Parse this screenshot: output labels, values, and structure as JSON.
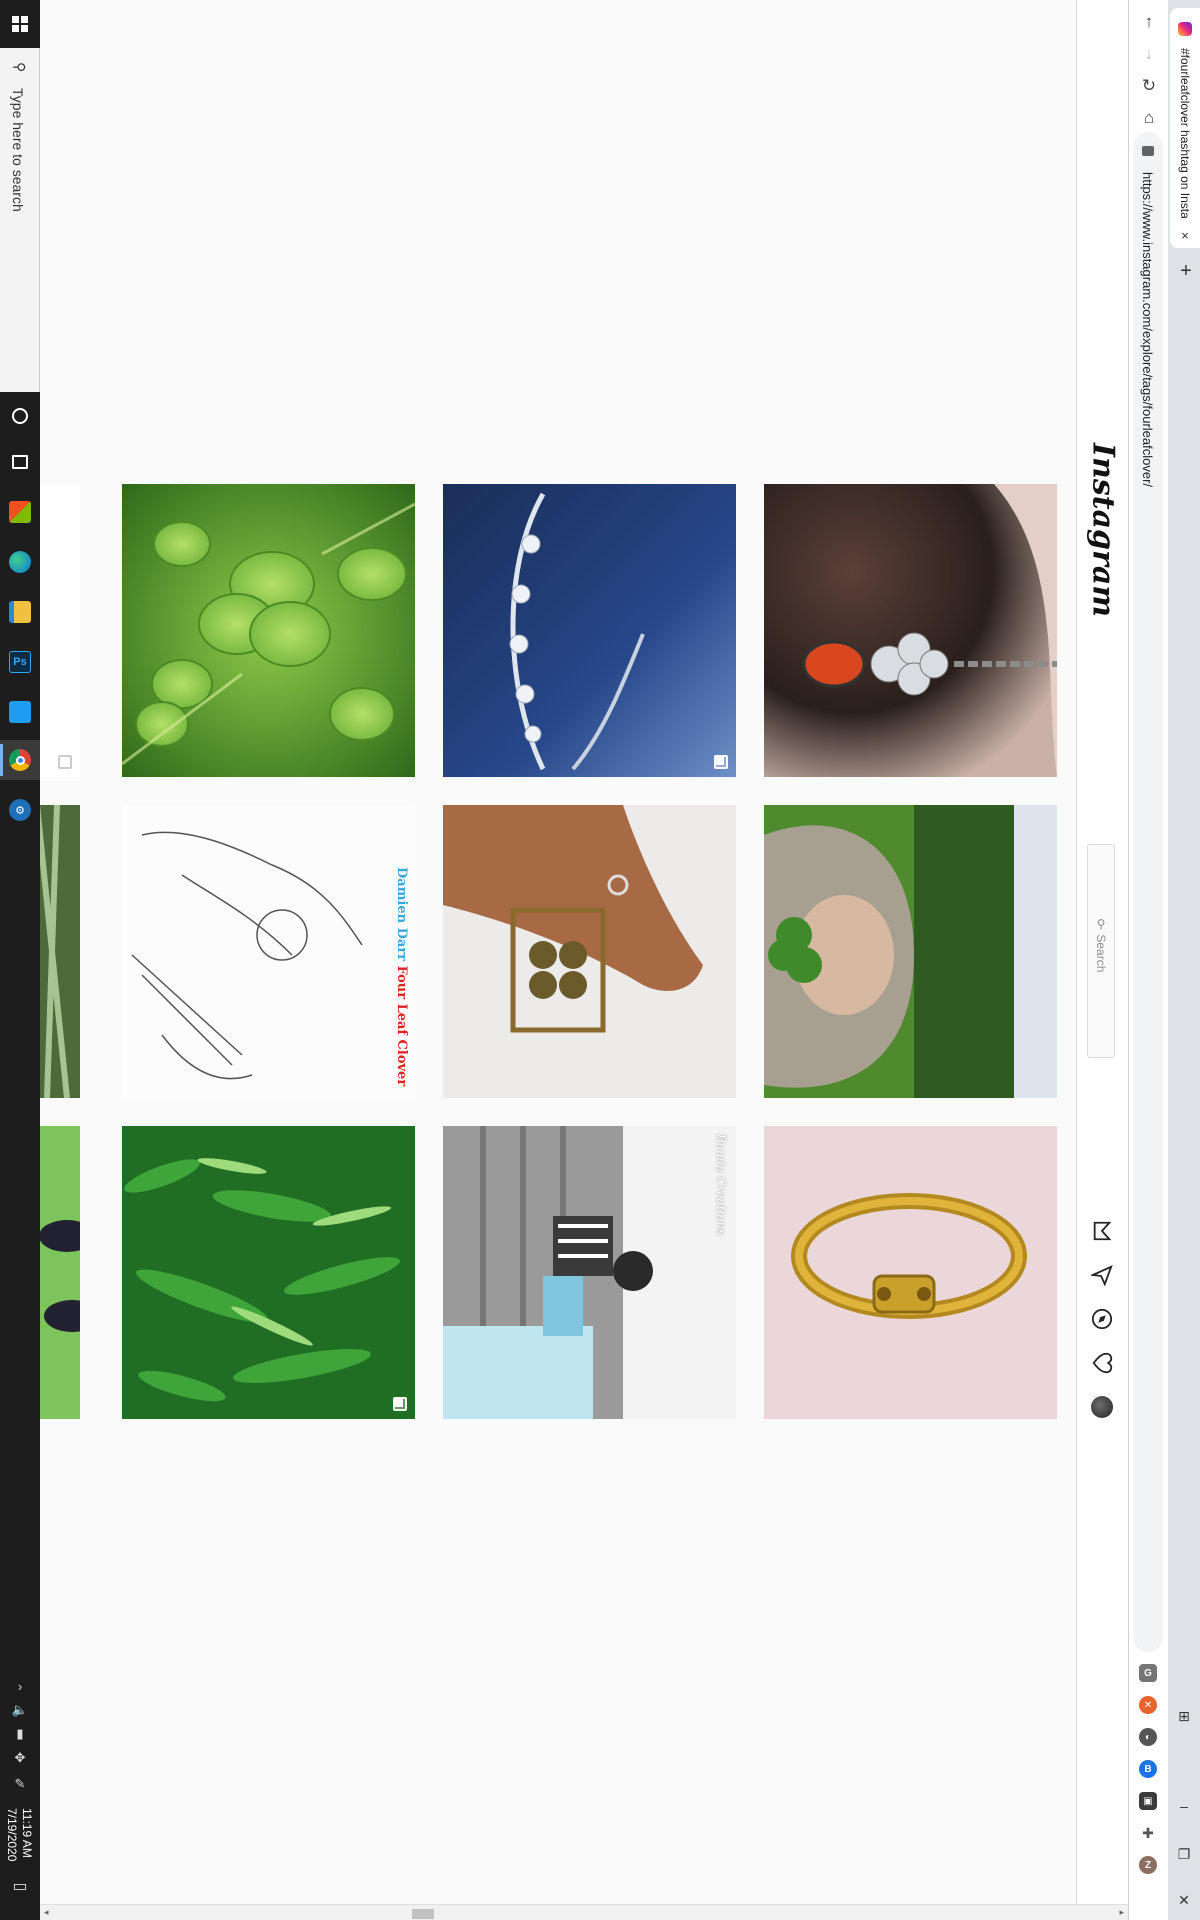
{
  "taskbar": {
    "search_placeholder": "Type here to search",
    "clock_time": "11:19 AM",
    "clock_date": "7/19/2020",
    "apps": [
      "cortana-icon",
      "task-view-icon",
      "store-icon",
      "edge-icon",
      "file-explorer-icon",
      "photoshop-icon",
      "vscode-icon",
      "chrome-icon",
      "settings-icon"
    ]
  },
  "browser": {
    "tab_title": "#fourleafclover hashtag on Insta",
    "url": "https://www.instagram.com/explore/tags/fourleafclover/",
    "new_tab": "+",
    "tab_close": "×",
    "close_window": "✕",
    "minimize": "–",
    "restore": "❐",
    "extensions": [
      "grammarly-icon",
      "ublock-icon",
      "dark-reader-icon",
      "bitwarden-icon",
      "screenshot-ext-icon",
      "puzzle-icon",
      "profile-icon"
    ],
    "profile_initial": "Z"
  },
  "instagram": {
    "logo_text": "Instagram",
    "search_placeholder": "Search",
    "nav": [
      "home-icon",
      "direct-icon",
      "explore-icon",
      "activity-icon",
      "profile-avatar"
    ]
  },
  "grid": {
    "posts": [
      {
        "subject": "partial-white-post",
        "multi": true
      },
      {
        "subject": "clover-leaves-photo",
        "multi": false
      },
      {
        "subject": "clover-bracelet-photo",
        "multi": true
      },
      {
        "subject": "ladybug-clover-charm-photo",
        "multi": false
      },
      {
        "subject": "partial-plant-photo",
        "multi": false
      },
      {
        "subject": "guitarist-sketch-post",
        "multi": false
      },
      {
        "subject": "framed-clover-hand-photo",
        "multi": false
      },
      {
        "subject": "hooded-person-clover-photo",
        "multi": false
      },
      {
        "subject": "partial-green-photo",
        "multi": false
      },
      {
        "subject": "green-clover-pattern-art",
        "multi": true
      },
      {
        "subject": "person-on-steps-photo",
        "multi": false
      },
      {
        "subject": "gold-ring-photo",
        "multi": false
      }
    ],
    "album_caption": {
      "artist": "Damien Darr",
      "title": "Four Leaf Clover"
    },
    "watermark": "Bouda Creations"
  },
  "colors": {
    "taskbar_bg": "#1d1d1d",
    "page_bg": "#fafafa",
    "accent_blue": "#7fb3e8"
  }
}
